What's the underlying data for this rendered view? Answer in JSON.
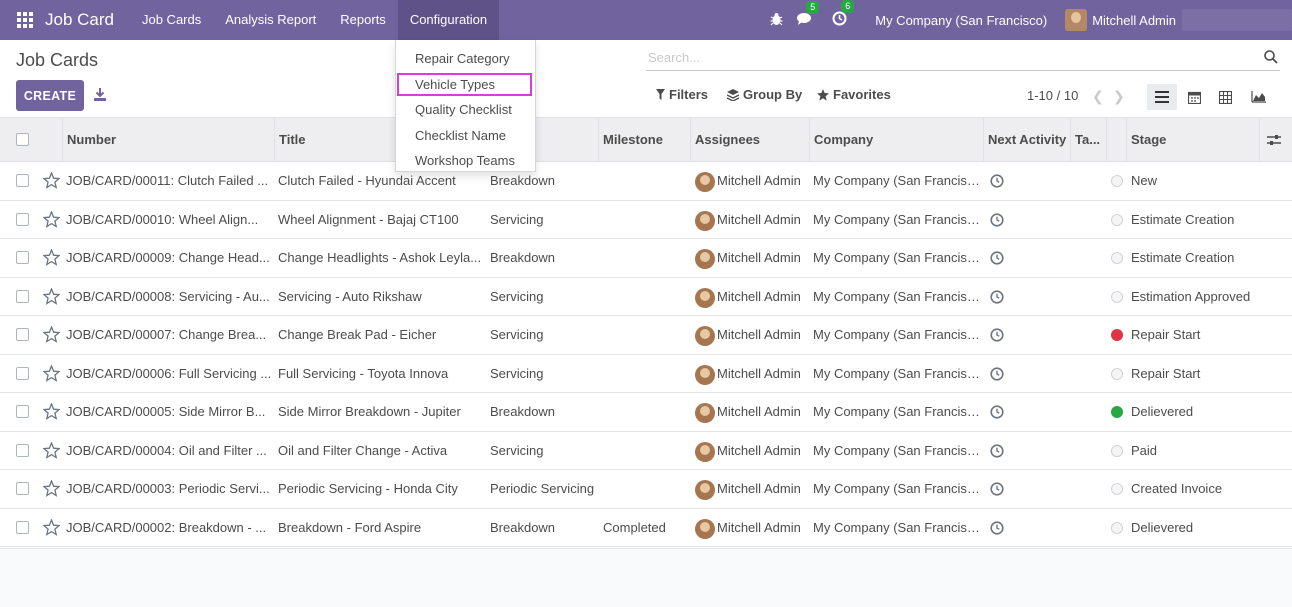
{
  "navbar": {
    "app_name": "Job Card",
    "menus": [
      "Job Cards",
      "Analysis Report",
      "Reports",
      "Configuration"
    ],
    "messages_count": "5",
    "activities_count": "6",
    "company": "My Company (San Francisco)",
    "user": "Mitchell Admin"
  },
  "control": {
    "title": "Job Cards",
    "create_label": "CREATE",
    "search_placeholder": "Search...",
    "filters_label": "Filters",
    "groupby_label": "Group By",
    "favorites_label": "Favorites",
    "pager": "1-10 / 10"
  },
  "dropdown": {
    "items": [
      "Repair Category",
      "Vehicle Types",
      "Quality Checklist",
      "Checklist Name",
      "Workshop Teams"
    ],
    "highlighted": "Vehicle Types"
  },
  "table": {
    "headers": [
      "Number",
      "Title",
      "Milestone",
      "Assignees",
      "Company",
      "Next Activity",
      "Ta...",
      "Stage"
    ],
    "rows": [
      {
        "number": "JOB/CARD/00011: Clutch Failed ...",
        "title": "Clutch Failed - Hyundai Accent",
        "type": "Breakdown",
        "milestone": "",
        "assignee": "Mitchell Admin",
        "company": "My Company (San Francisco)",
        "stage": "New",
        "status": "none"
      },
      {
        "number": "JOB/CARD/00010: Wheel Align...",
        "title": "Wheel Alignment - Bajaj CT100",
        "type": "Servicing",
        "milestone": "",
        "assignee": "Mitchell Admin",
        "company": "My Company (San Francisco)",
        "stage": "Estimate Creation",
        "status": "none"
      },
      {
        "number": "JOB/CARD/00009: Change Head...",
        "title": "Change Headlights - Ashok Leyla...",
        "type": "Breakdown",
        "milestone": "",
        "assignee": "Mitchell Admin",
        "company": "My Company (San Francisco)",
        "stage": "Estimate Creation",
        "status": "none"
      },
      {
        "number": "JOB/CARD/00008: Servicing - Au...",
        "title": "Servicing - Auto Rikshaw",
        "type": "Servicing",
        "milestone": "",
        "assignee": "Mitchell Admin",
        "company": "My Company (San Francisco)",
        "stage": "Estimation Approved",
        "status": "none"
      },
      {
        "number": "JOB/CARD/00007: Change Brea...",
        "title": "Change Break Pad - Eicher",
        "type": "Servicing",
        "milestone": "",
        "assignee": "Mitchell Admin",
        "company": "My Company (San Francisco)",
        "stage": "Repair Start",
        "status": "red"
      },
      {
        "number": "JOB/CARD/00006: Full Servicing ...",
        "title": "Full Servicing - Toyota Innova",
        "type": "Servicing",
        "milestone": "",
        "assignee": "Mitchell Admin",
        "company": "My Company (San Francisco)",
        "stage": "Repair Start",
        "status": "none"
      },
      {
        "number": "JOB/CARD/00005: Side Mirror B...",
        "title": "Side Mirror Breakdown - Jupiter",
        "type": "Breakdown",
        "milestone": "",
        "assignee": "Mitchell Admin",
        "company": "My Company (San Francisco)",
        "stage": "Delievered",
        "status": "green"
      },
      {
        "number": "JOB/CARD/00004: Oil and Filter ...",
        "title": "Oil and Filter Change - Activa",
        "type": "Servicing",
        "milestone": "",
        "assignee": "Mitchell Admin",
        "company": "My Company (San Francisco)",
        "stage": "Paid",
        "status": "none"
      },
      {
        "number": "JOB/CARD/00003: Periodic Servi...",
        "title": "Periodic Servicing - Honda City",
        "type": "Periodic Servicing",
        "milestone": "",
        "assignee": "Mitchell Admin",
        "company": "My Company (San Francisco)",
        "stage": "Created Invoice",
        "status": "none"
      },
      {
        "number": "JOB/CARD/00002: Breakdown - ...",
        "title": "Breakdown - Ford Aspire",
        "type": "Breakdown",
        "milestone": "Completed",
        "assignee": "Mitchell Admin",
        "company": "My Company (San Francisco)",
        "stage": "Delievered",
        "status": "none"
      }
    ]
  },
  "colors": {
    "brand": "#71639e",
    "status_red": "#dc3545",
    "status_green": "#28a745",
    "highlight_outline": "#d63fd6"
  }
}
